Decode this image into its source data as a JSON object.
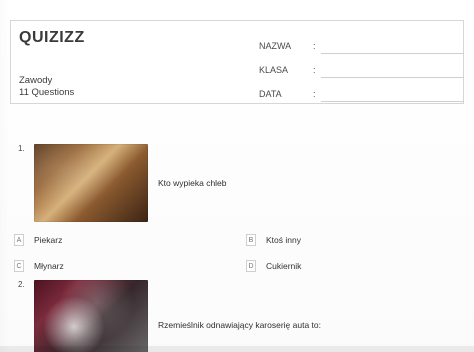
{
  "header": {
    "brand": "QUIZIZZ",
    "fields": [
      {
        "label": "NAZWA",
        "colon": ":"
      },
      {
        "label": "KLASA",
        "colon": ":"
      },
      {
        "label": "DATA",
        "colon": ":"
      }
    ],
    "quiz_title": "Zawody",
    "quiz_count": "11 Questions"
  },
  "questions": [
    {
      "number": "1.",
      "text": "Kto wypieka chleb",
      "image_icon": "bread-image",
      "answers": [
        {
          "letter": "A",
          "text": "Piekarz"
        },
        {
          "letter": "B",
          "text": "Ktoś inny"
        },
        {
          "letter": "C",
          "text": "Młynarz"
        },
        {
          "letter": "D",
          "text": "Cukiernik"
        }
      ]
    },
    {
      "number": "2.",
      "text": "Rzemieślnik odnawiający karoserię auta to:",
      "image_icon": "spray-image"
    }
  ]
}
